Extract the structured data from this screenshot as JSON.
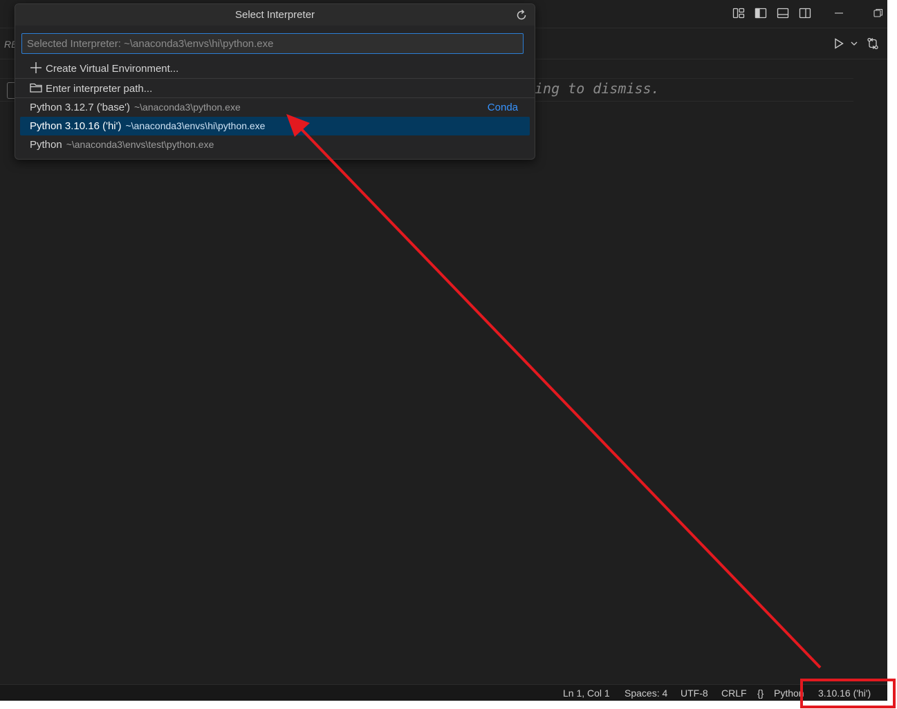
{
  "quickpick": {
    "title": "Select Interpreter",
    "input_placeholder": "Selected Interpreter: ~\\anaconda3\\envs\\hi\\python.exe",
    "actions": [
      {
        "icon": "plus-icon",
        "label": "Create Virtual Environment..."
      },
      {
        "icon": "folder-icon",
        "label": "Enter interpreter path..."
      }
    ],
    "interpreters": [
      {
        "label": "Python 3.12.7 ('base')",
        "path": "~\\anaconda3\\python.exe",
        "tag": "Conda",
        "selected": false
      },
      {
        "label": "Python 3.10.16 ('hi')",
        "path": "~\\anaconda3\\envs\\hi\\python.exe",
        "tag": "",
        "selected": true
      },
      {
        "label": "Python",
        "path": "~\\anaconda3\\envs\\test\\python.exe",
        "tag": "",
        "selected": false
      }
    ]
  },
  "editor": {
    "tab_partial": "RE",
    "hint_text": "ing to dismiss."
  },
  "statusbar": {
    "position": "Ln 1, Col 1",
    "spaces": "Spaces: 4",
    "encoding": "UTF-8",
    "eol": "CRLF",
    "language_braces": "{}",
    "language": "Python",
    "interpreter": "3.10.16 ('hi')"
  },
  "colors": {
    "accent": "#2c7fd6",
    "selection": "#04395e",
    "tag": "#3794ff",
    "annotation": "#e3191f"
  },
  "icons": {
    "titlebar": [
      "customize-layout-icon",
      "toggle-primary-sidebar-icon",
      "toggle-panel-icon",
      "toggle-secondary-sidebar-icon",
      "minimize-icon",
      "restore-icon"
    ],
    "editor_actions": [
      "run-icon",
      "run-dropdown-icon",
      "compare-changes-icon"
    ],
    "quickpick": [
      "refresh-icon"
    ]
  }
}
